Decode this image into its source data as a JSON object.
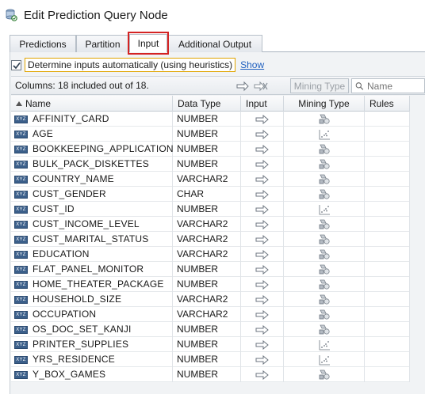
{
  "window": {
    "title": "Edit Prediction Query Node"
  },
  "tabs": [
    "Predictions",
    "Partition",
    "Input",
    "Additional Output"
  ],
  "active_tab": "Input",
  "heuristics": {
    "checked": true,
    "label": "Determine inputs automatically (using heuristics)",
    "show_link": "Show"
  },
  "toolbar": {
    "columns_label": "Columns: 18 included out of 18.",
    "mining_type_button": "Mining Type",
    "search_placeholder": "Name"
  },
  "grid": {
    "headers": {
      "name": "Name",
      "data_type": "Data Type",
      "input": "Input",
      "mining_type": "Mining Type",
      "rules": "Rules"
    },
    "rows": [
      {
        "name": "AFFINITY_CARD",
        "type": "NUMBER",
        "mining": "categorical"
      },
      {
        "name": "AGE",
        "type": "NUMBER",
        "mining": "numerical"
      },
      {
        "name": "BOOKKEEPING_APPLICATION",
        "type": "NUMBER",
        "mining": "categorical"
      },
      {
        "name": "BULK_PACK_DISKETTES",
        "type": "NUMBER",
        "mining": "categorical"
      },
      {
        "name": "COUNTRY_NAME",
        "type": "VARCHAR2",
        "mining": "categorical"
      },
      {
        "name": "CUST_GENDER",
        "type": "CHAR",
        "mining": "categorical"
      },
      {
        "name": "CUST_ID",
        "type": "NUMBER",
        "mining": "numerical"
      },
      {
        "name": "CUST_INCOME_LEVEL",
        "type": "VARCHAR2",
        "mining": "categorical"
      },
      {
        "name": "CUST_MARITAL_STATUS",
        "type": "VARCHAR2",
        "mining": "categorical"
      },
      {
        "name": "EDUCATION",
        "type": "VARCHAR2",
        "mining": "categorical"
      },
      {
        "name": "FLAT_PANEL_MONITOR",
        "type": "NUMBER",
        "mining": "categorical"
      },
      {
        "name": "HOME_THEATER_PACKAGE",
        "type": "NUMBER",
        "mining": "categorical"
      },
      {
        "name": "HOUSEHOLD_SIZE",
        "type": "VARCHAR2",
        "mining": "categorical"
      },
      {
        "name": "OCCUPATION",
        "type": "VARCHAR2",
        "mining": "categorical"
      },
      {
        "name": "OS_DOC_SET_KANJI",
        "type": "NUMBER",
        "mining": "categorical"
      },
      {
        "name": "PRINTER_SUPPLIES",
        "type": "NUMBER",
        "mining": "numerical"
      },
      {
        "name": "YRS_RESIDENCE",
        "type": "NUMBER",
        "mining": "numerical"
      },
      {
        "name": "Y_BOX_GAMES",
        "type": "NUMBER",
        "mining": "categorical"
      }
    ]
  },
  "type_icon_text": "XYZ",
  "icons": {
    "title": "prediction-node-icon",
    "input_arrow": "right-arrow-icon",
    "mining_categorical": "categorical-shapes-icon",
    "mining_numerical": "scatter-plot-icon",
    "column_type": "column-type-icon"
  }
}
